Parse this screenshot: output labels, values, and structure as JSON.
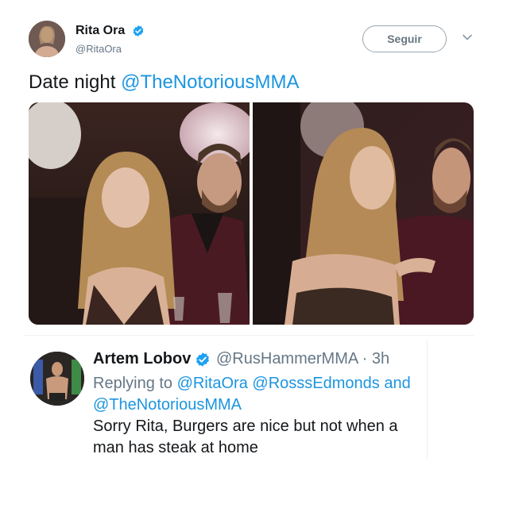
{
  "tweet": {
    "author": {
      "display_name": "Rita Ora",
      "handle": "@RitaOra",
      "verified": true
    },
    "follow_label": "Seguir",
    "text_prefix": "Date night ",
    "text_mention": "@TheNotoriousMMA",
    "photos": [
      {
        "icon": "photo-couple-at-table"
      },
      {
        "icon": "photo-couple-talking"
      }
    ]
  },
  "reply": {
    "author": {
      "display_name": "Artem Lobov",
      "handle": "@RusHammerMMA",
      "time": "3h",
      "verified": true
    },
    "replying_to_prefix": "Replying to ",
    "replying_to_mentions": [
      "@RitaOra",
      "@RosssEdmonds",
      "@TheNotoriousMMA"
    ],
    "replying_to_joiner": "and",
    "text": "Sorry Rita, Burgers are nice but not when a man has steak at home"
  },
  "colors": {
    "link": "#1b95e0",
    "verified": "#1da1f2",
    "secondary_text": "#657786",
    "primary_text": "#14171a"
  }
}
